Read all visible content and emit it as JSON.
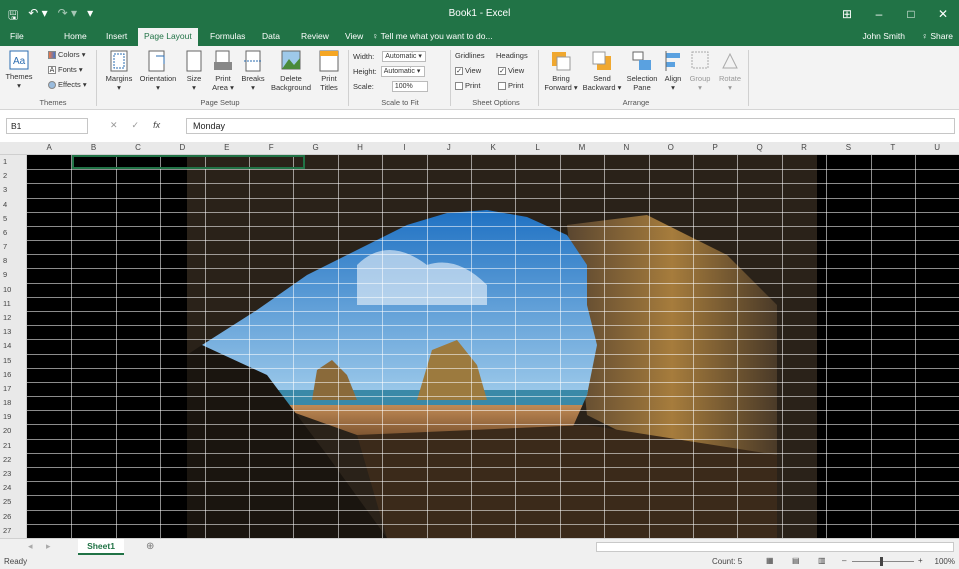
{
  "titlebar": {
    "title": "Book1 - Excel",
    "qat_save": "🖫",
    "qat_undo": "↶ ▾",
    "qat_redo": "↷ ▾",
    "qat_more": "▾",
    "ribbon_display": "⊞",
    "minimize": "–",
    "maximize": "□",
    "close": "✕"
  },
  "tabs": {
    "file": "File",
    "home": "Home",
    "insert": "Insert",
    "page_layout": "Page Layout",
    "formulas": "Formulas",
    "data": "Data",
    "review": "Review",
    "view": "View",
    "tell_me": "♀ Tell me what you want to do...",
    "user": "John Smith",
    "share": "♀ Share"
  },
  "ribbon": {
    "themes": {
      "label": "Themes",
      "colors": "Colors ▾",
      "fonts": "Fonts ▾",
      "effects": "Effects ▾",
      "group": "Themes"
    },
    "page_setup": {
      "margins": "Margins",
      "orientation": "Orientation",
      "size": "Size",
      "print_area": "Print Area ▾",
      "breaks": "Breaks",
      "delete_background": "Delete Background",
      "print_titles": "Print Titles",
      "group": "Page Setup"
    },
    "scale": {
      "width_label": "Width:",
      "width_value": "Automatic ▾",
      "height_label": "Height:",
      "height_value": "Automatic ▾",
      "scale_label": "Scale:",
      "scale_value": "100%",
      "group": "Scale to Fit"
    },
    "sheet_options": {
      "gridlines": "Gridlines",
      "headings": "Headings",
      "view": "View",
      "print": "Print",
      "group": "Sheet Options"
    },
    "arrange": {
      "bring_forward": "Bring Forward ▾",
      "send_backward": "Send Backward ▾",
      "selection_pane": "Selection Pane",
      "align": "Align",
      "group_btn": "Group",
      "rotate": "Rotate",
      "group": "Arrange"
    }
  },
  "formula_bar": {
    "name_box": "B1",
    "cancel": "✕",
    "enter": "✓",
    "fx": "fx",
    "content": "Monday"
  },
  "columns": [
    "A",
    "B",
    "C",
    "D",
    "E",
    "F",
    "G",
    "H",
    "I",
    "J",
    "K",
    "L",
    "M",
    "N",
    "O",
    "P",
    "Q",
    "R",
    "S",
    "T",
    "U"
  ],
  "rows": [
    "1",
    "2",
    "3",
    "4",
    "5",
    "6",
    "7",
    "8",
    "9",
    "10",
    "11",
    "12",
    "13",
    "14",
    "15",
    "16",
    "17",
    "18",
    "19",
    "20",
    "21",
    "22",
    "23",
    "24",
    "25",
    "26",
    "27"
  ],
  "sheet_tabs": {
    "active": "Sheet1",
    "add": "⊕"
  },
  "status": {
    "ready": "Ready",
    "count": "Count: 5",
    "zoom": "100%"
  }
}
